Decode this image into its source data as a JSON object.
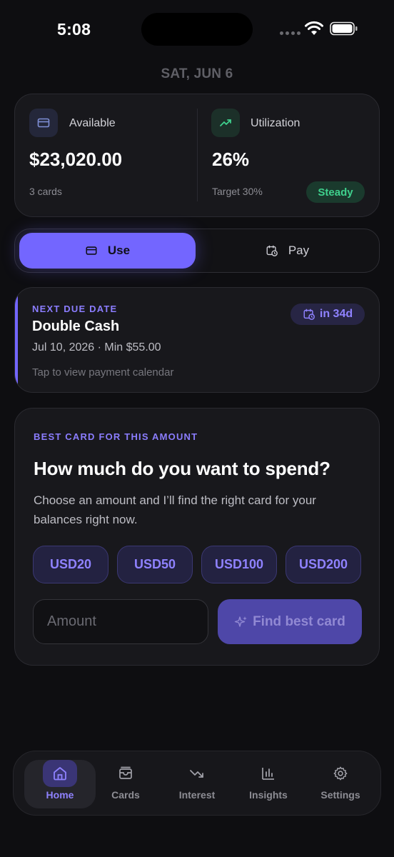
{
  "status_bar": {
    "time": "5:08"
  },
  "date_label": "SAT, JUN 6",
  "summary": {
    "available": {
      "label": "Available",
      "value": "$23,020.00",
      "sub": "3 cards",
      "icon": "card-icon"
    },
    "utilization": {
      "label": "Utilization",
      "value": "26%",
      "sub": "Target 30%",
      "badge": "Steady",
      "icon": "trend-up-icon"
    }
  },
  "segmented": {
    "use_label": "Use",
    "pay_label": "Pay",
    "selected": "Use"
  },
  "due": {
    "kicker": "NEXT DUE DATE",
    "title": "Double Cash",
    "meta": "Jul 10, 2026 · Min $55.00",
    "hint": "Tap to view payment calendar",
    "badge": "in 34d"
  },
  "best": {
    "kicker": "BEST CARD FOR THIS AMOUNT",
    "title": "How much do you want to spend?",
    "description": "Choose an amount and I’ll find the right card for your balances right now.",
    "chips": [
      "USD20",
      "USD50",
      "USD100",
      "USD200"
    ],
    "amount_placeholder": "Amount",
    "find_label": "Find best card"
  },
  "tabs": [
    {
      "label": "Home",
      "icon": "home-icon",
      "active": true
    },
    {
      "label": "Cards",
      "icon": "cards-icon",
      "active": false
    },
    {
      "label": "Interest",
      "icon": "trend-down-icon",
      "active": false
    },
    {
      "label": "Insights",
      "icon": "bar-chart-icon",
      "active": false
    },
    {
      "label": "Settings",
      "icon": "gear-icon",
      "active": false
    }
  ],
  "colors": {
    "accent": "#7366ff",
    "accent_text": "#8b7dff",
    "success": "#3fd18d",
    "background": "#0e0e11",
    "card": "#18181c"
  }
}
